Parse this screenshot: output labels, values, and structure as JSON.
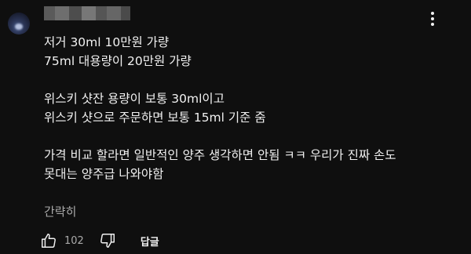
{
  "comment": {
    "lines": [
      "저거 30ml 10만원 가량",
      "75ml 대용량이 20만원 가량",
      "",
      "위스키 샷잔 용량이 보통 30ml이고",
      "위스키 샷으로 주문하면 보통 15ml 기준 줌",
      "",
      "가격 비교 할라면 일반적인 양주 생각하면 안됨 ㅋㅋ 우리가 진짜 손도",
      "못대는 양주급 나와야함"
    ],
    "read_less_label": "간략히"
  },
  "actions": {
    "like_count": "102",
    "reply_label": "답글",
    "like_icon": "thumbs-up-icon",
    "dislike_icon": "thumbs-down-icon",
    "more_icon": "more-vertical-icon"
  },
  "colors": {
    "background": "#0f0f0f",
    "text": "#f1f1f1",
    "secondary_text": "#aaaaaa"
  }
}
